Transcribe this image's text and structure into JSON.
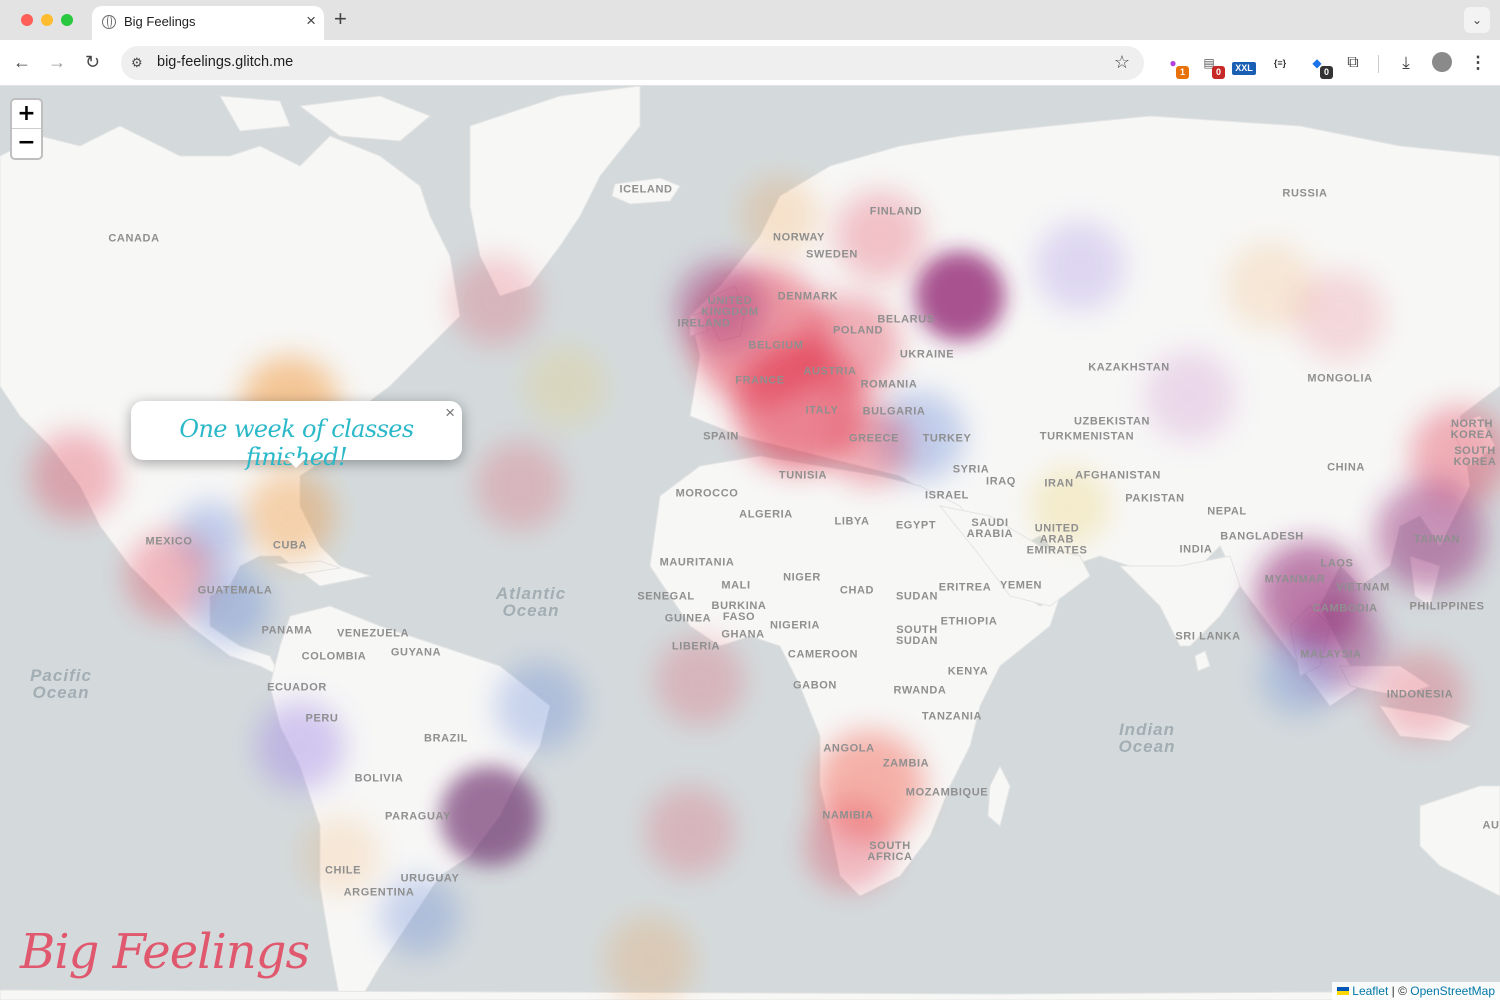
{
  "browser": {
    "tab_title": "Big Feelings",
    "url": "big-feelings.glitch.me",
    "extensions": [
      {
        "name": "extension-1",
        "badge": "1",
        "badge_color": "#e8710a"
      },
      {
        "name": "extension-2",
        "badge": "0",
        "badge_color": "#c62828"
      },
      {
        "name": "extension-3",
        "label": "XXL"
      },
      {
        "name": "extension-4",
        "label": "{≡}"
      },
      {
        "name": "extension-5",
        "badge": "0",
        "badge_color": "#333333"
      }
    ]
  },
  "map": {
    "zoom_in": "+",
    "zoom_out": "−",
    "popup": {
      "text": "One week of classes finished!",
      "close": "×"
    },
    "brand": "Big Feelings",
    "attribution": {
      "leaflet": "Leaflet",
      "separator": " | © ",
      "osm": "OpenStreetMap"
    },
    "oceans": [
      {
        "text": "Atlantic\nOcean"
      },
      {
        "text": "Pacific\nOcean"
      },
      {
        "text": "Indian\nOcean"
      }
    ],
    "country_labels": [
      "ICELAND",
      "CANADA",
      "RUSSIA",
      "FINLAND",
      "NORWAY",
      "SWEDEN",
      "DENMARK",
      "UNITED\nKINGDOM",
      "IRELAND",
      "BELGIUM",
      "POLAND",
      "BELARUS",
      "UKRAINE",
      "FRANCE",
      "AUSTRIA",
      "ROMANIA",
      "SPAIN",
      "ITALY",
      "BULGARIA",
      "GREECE",
      "TURKEY",
      "KAZAKHSTAN",
      "MONGOLIA",
      "UZBEKISTAN",
      "TURKMENISTAN",
      "SYRIA",
      "IRAQ",
      "IRAN",
      "AFGHANISTAN",
      "PAKISTAN",
      "CHINA",
      "NORTH\nKOREA",
      "SOUTH\nKOREA",
      "TUNISIA",
      "MOROCCO",
      "ALGERIA",
      "LIBYA",
      "EGYPT",
      "ISRAEL",
      "SAUDI\nARABIA",
      "UNITED\nARAB\nEMIRATES",
      "NEPAL",
      "BANGLADESH",
      "INDIA",
      "TAIWAN",
      "MYANMAR",
      "LAOS",
      "VIETNAM",
      "CAMBODIA",
      "PHILIPPINES",
      "MAURITANIA",
      "MALI",
      "NIGER",
      "CHAD",
      "SUDAN",
      "ERITREA",
      "YEMEN",
      "SENEGAL",
      "BURKINA\nFASO",
      "GUINEA",
      "GHANA",
      "NIGERIA",
      "SOUTH\nSUDAN",
      "ETHIOPIA",
      "LIBERIA",
      "CAMEROON",
      "KENYA",
      "SRI LANKA",
      "MALAYSIA",
      "GABON",
      "RWANDA",
      "TANZANIA",
      "INDONESIA",
      "ANGOLA",
      "ZAMBIA",
      "MOZAMBIQUE",
      "NAMIBIA",
      "SOUTH\nAFRICA",
      "AU",
      "MEXICO",
      "CUBA",
      "GUATEMALA",
      "PANAMA",
      "VENEZUELA",
      "GUYANA",
      "COLOMBIA",
      "ECUADOR",
      "PERU",
      "BRAZIL",
      "BOLIVIA",
      "PARAGUAY",
      "CHILE",
      "URUGUAY",
      "ARGENTINA"
    ],
    "feeling_colors": {
      "red": "#e0263f",
      "purple": "#8e1f6e",
      "orange": "#f08a24",
      "blue": "#5b7fd6",
      "lavender": "#a58ce6",
      "yellow": "#e9c84a"
    }
  }
}
